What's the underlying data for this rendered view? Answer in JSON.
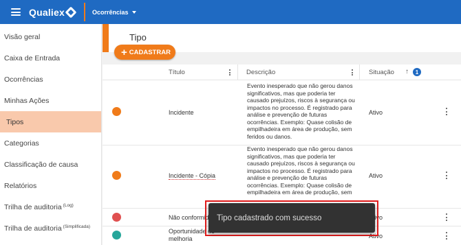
{
  "header": {
    "brand": "Qualiex",
    "module": "Ocorrências"
  },
  "sidebar": {
    "items": [
      {
        "label": "Visão geral"
      },
      {
        "label": "Caixa de Entrada"
      },
      {
        "label": "Ocorrências"
      },
      {
        "label": "Minhas Ações"
      },
      {
        "label": "Tipos",
        "active": true
      },
      {
        "label": "Categorias"
      },
      {
        "label": "Classificação de causa"
      },
      {
        "label": "Relatórios"
      },
      {
        "label": "Trilha de auditoria",
        "suffix": "(Log)"
      },
      {
        "label": "Trilha de auditoria",
        "suffix": "(Simplificada)"
      }
    ]
  },
  "page": {
    "title": "Tipo",
    "add_button": "CADASTRAR"
  },
  "table": {
    "columns": [
      "Título",
      "Descrição",
      "Situação"
    ],
    "sort_arrow": "↑",
    "info_badge": "1",
    "rows": [
      {
        "color": "#f07b1a",
        "title": "Incidente",
        "description": "Evento inesperado que não gerou danos significativos, mas que poderia ter causado prejuízos, riscos à segurança ou impactos no processo. É registrado para análise e prevenção de futuras ocorrências. Exemplo: Quase colisão de empilhadeira em área de produção, sem feridos ou danos.",
        "status": "Ativo"
      },
      {
        "color": "#f07b1a",
        "title": "Incidente - Cópia",
        "description": "Evento inesperado que não gerou danos significativos, mas que poderia ter causado prejuízos, riscos à segurança ou impactos no processo. É registrado para análise e prevenção de futuras ocorrências. Exemplo: Quase colisão de empilhadeira em área de produção, sem feridos ou danos.",
        "status": "Ativo"
      },
      {
        "color": "#e05050",
        "title": "Não conformid",
        "description": "",
        "status": "Ativo"
      },
      {
        "color": "#26a69a",
        "title": "Oportunidade de melhoria",
        "description": "",
        "status": "Ativo"
      }
    ]
  },
  "toast": {
    "message": "Tipo cadastrado com sucesso"
  }
}
